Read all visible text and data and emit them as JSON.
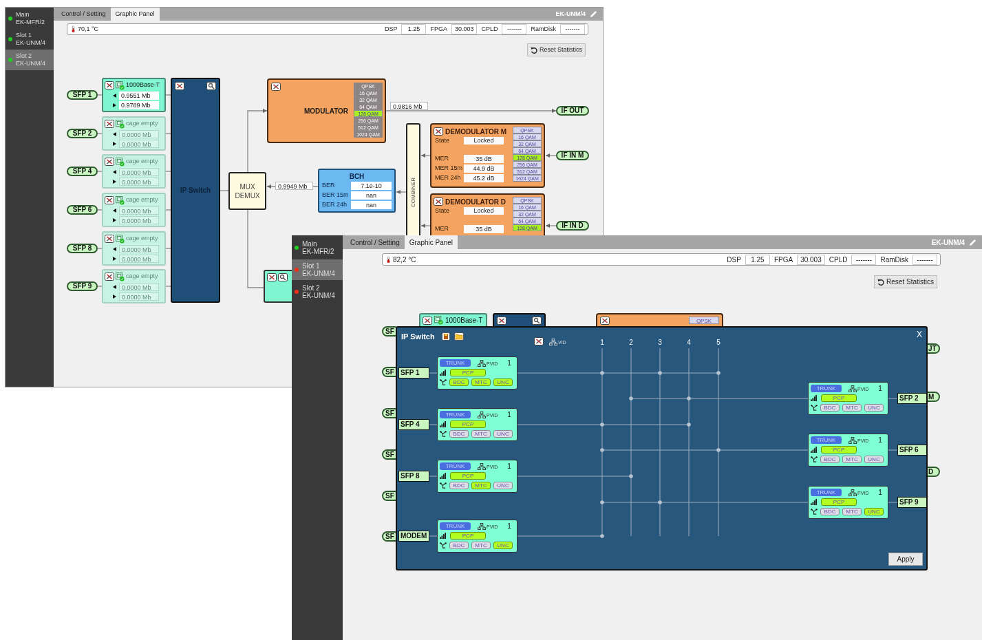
{
  "back_window": {
    "sidebar": [
      {
        "title": "Main",
        "subtitle": "EK-MFR/2",
        "color": "#22cc22",
        "selected": false
      },
      {
        "title": "Slot 1",
        "subtitle": "EK-UNM/4",
        "color": "#22cc22",
        "selected": false
      },
      {
        "title": "Slot 2",
        "subtitle": "EK-UNM/4",
        "color": "#22cc22",
        "selected": true
      }
    ],
    "tabs": [
      {
        "label": "Control / Setting",
        "selected": false
      },
      {
        "label": "Graphic Panel",
        "selected": true
      }
    ],
    "device": "EK-UNM/4",
    "status_bar": {
      "temperature": "70,1 °C",
      "readings": [
        {
          "label": "DSP",
          "value": "1.25"
        },
        {
          "label": "FPGA",
          "value": "30.003"
        },
        {
          "label": "CPLD",
          "value": "-------"
        },
        {
          "label": "RamDisk",
          "value": "-------"
        }
      ]
    },
    "reset_button": "Reset Statistics",
    "diagram": {
      "sfp_ports": [
        {
          "label": "SFP 1",
          "module": "1000Base-T",
          "active": true,
          "rx": "0.9551 Mb",
          "tx": "0.9789 Mb"
        },
        {
          "label": "SFP 2",
          "module": "cage empty",
          "active": false,
          "rx": "0.0000 Mb",
          "tx": "0.0000 Mb"
        },
        {
          "label": "SFP 4",
          "module": "cage empty",
          "active": false,
          "rx": "0.0000 Mb",
          "tx": "0.0000 Mb"
        },
        {
          "label": "SFP 6",
          "module": "cage empty",
          "active": false,
          "rx": "0.0000 Mb",
          "tx": "0.0000 Mb"
        },
        {
          "label": "SFP 8",
          "module": "cage empty",
          "active": false,
          "rx": "0.0000 Mb",
          "tx": "0.0000 Mb"
        },
        {
          "label": "SFP 9",
          "module": "cage empty",
          "active": false,
          "rx": "0.0000 Mb",
          "tx": "0.0000 Mb"
        }
      ],
      "ip_switch": "IP Switch",
      "mux": [
        "MUX",
        "DEMUX"
      ],
      "mux_rate": "0.9949 Mb",
      "modulator": {
        "title": "MODULATOR",
        "modulations": [
          {
            "label": "QPSK",
            "selected": false
          },
          {
            "label": "16 QAM",
            "selected": false
          },
          {
            "label": "32 QAM",
            "selected": false
          },
          {
            "label": "64 QAM",
            "selected": false
          },
          {
            "label": "128 QAM",
            "selected": true
          },
          {
            "label": "256 QAM",
            "selected": false
          },
          {
            "label": "512 QAM",
            "selected": false
          },
          {
            "label": "1024 QAM",
            "selected": false
          }
        ],
        "rate": "0.9816 Mb",
        "output": "IF OUT"
      },
      "bch": {
        "title": "BCH",
        "rows": [
          {
            "label": "BER",
            "value": "7.1e-10"
          },
          {
            "label": "BER 15m",
            "value": "nan"
          },
          {
            "label": "BER 24h",
            "value": "nan"
          }
        ]
      },
      "combiner": "COMBINER",
      "demodulators": [
        {
          "title": "DEMODULATOR M",
          "state_label": "State",
          "state": "Locked",
          "rows": [
            {
              "label": "MER",
              "value": "35 dB"
            },
            {
              "label": "MER 15m",
              "value": "44.9 dB"
            },
            {
              "label": "MER 24h",
              "value": "45.2 dB"
            }
          ],
          "modulations": [
            {
              "label": "QPSK",
              "selected": false
            },
            {
              "label": "16 QAM",
              "selected": false
            },
            {
              "label": "32 QAM",
              "selected": false
            },
            {
              "label": "64 QAM",
              "selected": false
            },
            {
              "label": "128 QAM",
              "selected": true
            },
            {
              "label": "256 QAM",
              "selected": false
            },
            {
              "label": "512 QAM",
              "selected": false
            },
            {
              "label": "1024 QAM",
              "selected": false
            }
          ],
          "input": "IF IN M"
        },
        {
          "title": "DEMODULATOR D",
          "state_label": "State",
          "state": "Locked",
          "rows": [
            {
              "label": "MER",
              "value": "35 dB"
            }
          ],
          "modulations": [
            {
              "label": "QPSK",
              "selected": false
            },
            {
              "label": "16 QAM",
              "selected": false
            },
            {
              "label": "32 QAM",
              "selected": false
            },
            {
              "label": "64 QAM",
              "selected": false
            },
            {
              "label": "128 QAM",
              "selected": true
            }
          ],
          "input": "IF IN D"
        }
      ]
    }
  },
  "front_window": {
    "sidebar": [
      {
        "title": "Main",
        "subtitle": "EK-MFR/2",
        "color": "#22cc22",
        "selected": false
      },
      {
        "title": "Slot 1",
        "subtitle": "EK-UNM/4",
        "color": "#ee3311",
        "selected": true
      },
      {
        "title": "Slot 2",
        "subtitle": "EK-UNM/4",
        "color": "#ee3311",
        "selected": false
      }
    ],
    "tabs": [
      {
        "label": "Control / Setting",
        "selected": false
      },
      {
        "label": "Graphic Panel",
        "selected": true
      }
    ],
    "device": "EK-UNM/4",
    "status_bar": {
      "temperature": "82,2 °C",
      "readings": [
        {
          "label": "DSP",
          "value": "1.25"
        },
        {
          "label": "FPGA",
          "value": "30.003"
        },
        {
          "label": "CPLD",
          "value": "-------"
        },
        {
          "label": "RamDisk",
          "value": "-------"
        }
      ]
    },
    "reset_button": "Reset Statistics",
    "background": {
      "port_pills": [
        "SF",
        "SF",
        "SF",
        "SF",
        "SF",
        "SF"
      ],
      "module_card": "1000Base-T",
      "modulator_card": "QPSK",
      "right_pills": [
        "JT",
        "M",
        "D"
      ]
    },
    "ip_switch": {
      "title": "IP Switch",
      "close": "X",
      "vid_label": "VID",
      "columns": [
        "1",
        "2",
        "3",
        "4",
        "5"
      ],
      "ports": [
        {
          "label": "SFP 1",
          "mode": "TRUNK",
          "pvid_label": "PVID",
          "pvid": "1",
          "pcp": "PCP",
          "flags": [
            {
              "label": "BDC",
              "on": true
            },
            {
              "label": "MTC",
              "on": true
            },
            {
              "label": "UNC",
              "on": true
            }
          ],
          "members": [
            true,
            false,
            true,
            false,
            true
          ]
        },
        {
          "label": "SFP 2",
          "mode": "TRUNK",
          "pvid_label": "PVID",
          "pvid": "1",
          "pcp": "PCP",
          "flags": [
            {
              "label": "BDC",
              "on": false
            },
            {
              "label": "MTC",
              "on": false
            },
            {
              "label": "UNC",
              "on": false
            }
          ],
          "members": [
            false,
            true,
            false,
            true,
            false
          ]
        },
        {
          "label": "SFP 4",
          "mode": "TRUNK",
          "pvid_label": "PVID",
          "pvid": "1",
          "pcp": "PCP",
          "flags": [
            {
              "label": "BDC",
              "on": false
            },
            {
              "label": "MTC",
              "on": false
            },
            {
              "label": "UNC",
              "on": false
            }
          ],
          "members": [
            true,
            false,
            false,
            true,
            false
          ]
        },
        {
          "label": "SFP 6",
          "mode": "TRUNK",
          "pvid_label": "PVID",
          "pvid": "1",
          "pcp": "PCP",
          "flags": [
            {
              "label": "BDC",
              "on": false
            },
            {
              "label": "MTC",
              "on": false
            },
            {
              "label": "UNC",
              "on": false
            }
          ],
          "members": [
            true,
            false,
            false,
            false,
            true
          ]
        },
        {
          "label": "SFP 8",
          "mode": "TRUNK",
          "pvid_label": "PVID",
          "pvid": "1",
          "pcp": "PCP",
          "flags": [
            {
              "label": "BDC",
              "on": false
            },
            {
              "label": "MTC",
              "on": true
            },
            {
              "label": "UNC",
              "on": false
            }
          ],
          "members": [
            false,
            true,
            false,
            false,
            false
          ]
        },
        {
          "label": "SFP 9",
          "mode": "TRUNK",
          "pvid_label": "PVID",
          "pvid": "1",
          "pcp": "PCP",
          "flags": [
            {
              "label": "BDC",
              "on": false
            },
            {
              "label": "MTC",
              "on": false
            },
            {
              "label": "UNC",
              "on": true
            }
          ],
          "members": [
            true,
            false,
            true,
            false,
            false
          ]
        },
        {
          "label": "MODEM",
          "mode": "TRUNK",
          "pvid_label": "PVID",
          "pvid": "1",
          "pcp": "PCP",
          "flags": [
            {
              "label": "BDC",
              "on": false
            },
            {
              "label": "MTC",
              "on": false
            },
            {
              "label": "UNC",
              "on": true
            }
          ],
          "members": [
            true,
            false,
            false,
            false,
            false
          ]
        }
      ],
      "apply": "Apply"
    }
  }
}
